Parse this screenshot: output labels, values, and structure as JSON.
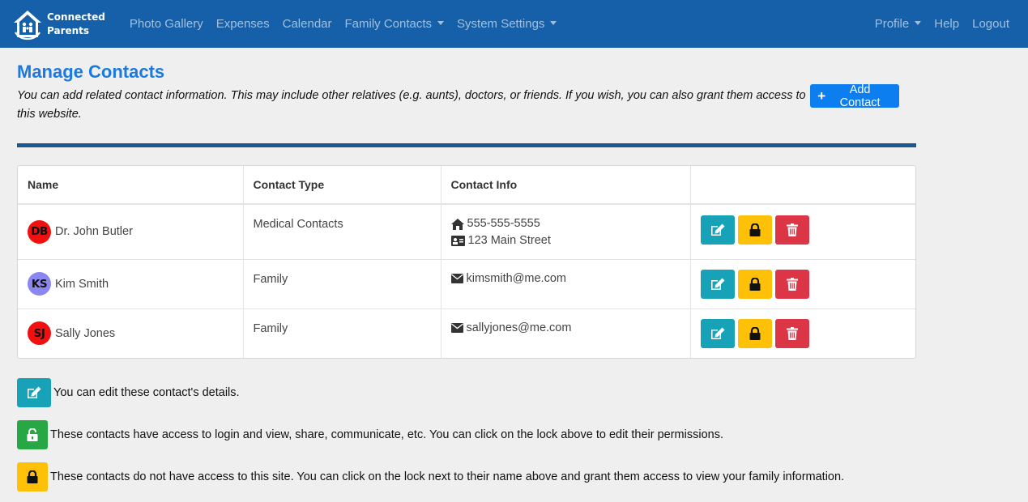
{
  "brand": {
    "line1": "Connected",
    "line2": "Parents"
  },
  "nav": {
    "left": [
      {
        "label": "Photo Gallery",
        "dropdown": false
      },
      {
        "label": "Expenses",
        "dropdown": false
      },
      {
        "label": "Calendar",
        "dropdown": false
      },
      {
        "label": "Family Contacts",
        "dropdown": true
      },
      {
        "label": "System Settings",
        "dropdown": true
      }
    ],
    "right": [
      {
        "label": "Profile",
        "dropdown": true
      },
      {
        "label": "Help",
        "dropdown": false
      },
      {
        "label": "Logout",
        "dropdown": false
      }
    ]
  },
  "page": {
    "title": "Manage Contacts",
    "intro": "You can add related contact information. This may include other relatives (e.g. aunts), doctors, or friends. If you wish, you can also grant them access to this website.",
    "add_button": "Add Contact"
  },
  "table": {
    "headers": [
      "Name",
      "Contact Type",
      "Contact Info",
      ""
    ],
    "rows": [
      {
        "initials": "DB",
        "avatar_color": "#f01010",
        "name": "Dr. John Butler",
        "type": "Medical Contacts",
        "info": [
          {
            "icon": "home-icon",
            "text": "555-555-5555"
          },
          {
            "icon": "address-card-icon",
            "text": "123 Main Street"
          }
        ]
      },
      {
        "initials": "KS",
        "avatar_color": "#8b87f0",
        "name": "Kim Smith",
        "type": "Family",
        "info": [
          {
            "icon": "envelope-icon",
            "text": "kimsmith@me.com"
          }
        ]
      },
      {
        "initials": "SJ",
        "avatar_color": "#f01010",
        "name": "Sally Jones",
        "type": "Family",
        "info": [
          {
            "icon": "envelope-icon",
            "text": "sallyjones@me.com"
          }
        ]
      }
    ]
  },
  "legend": {
    "edit": "You can edit these contact's details.",
    "unlocked": "These contacts have access to login and view, share, communicate, etc. You can click on the lock above to edit their permissions.",
    "locked": "These contacts do not have access to this site. You can click on the lock next to their name above and grant them access to view your family information."
  },
  "colors": {
    "navbar": "#1560a8",
    "title": "#1a7ae0",
    "edit": "#17a2b8",
    "lock": "#ffc107",
    "delete": "#dc3545",
    "unlocked": "#28a745"
  }
}
